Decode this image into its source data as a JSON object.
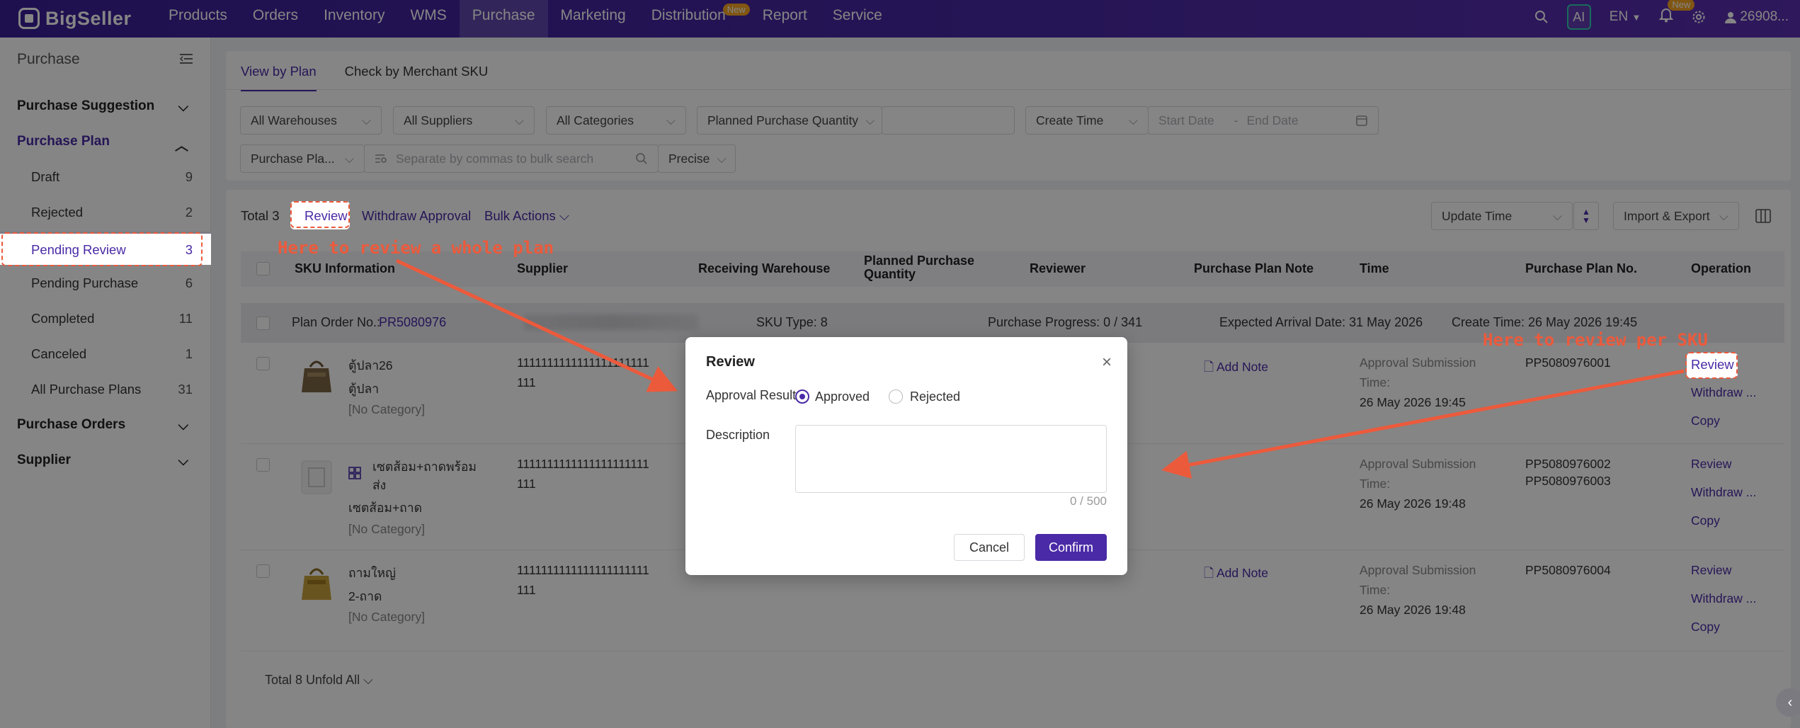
{
  "topbar": {
    "brand": "BigSeller",
    "nav": [
      "Products",
      "Orders",
      "Inventory",
      "WMS",
      "Purchase",
      "Marketing",
      "Distribution",
      "Report",
      "Service"
    ],
    "distribution_badge": "New",
    "ai": "AI",
    "lang": "EN",
    "bell_badge": "New",
    "user": "26908..."
  },
  "sidebar": {
    "title": "Purchase",
    "groups": {
      "suggestion": "Purchase Suggestion",
      "plan": "Purchase Plan",
      "orders": "Purchase Orders",
      "supplier": "Supplier"
    },
    "items": [
      {
        "label": "Draft",
        "count": "9"
      },
      {
        "label": "Rejected",
        "count": "2"
      },
      {
        "label": "Pending Review",
        "count": "3"
      },
      {
        "label": "Pending Purchase",
        "count": "6"
      },
      {
        "label": "Completed",
        "count": "11"
      },
      {
        "label": "Canceled",
        "count": "1"
      },
      {
        "label": "All Purchase Plans",
        "count": "31"
      }
    ]
  },
  "tabs": {
    "view_by_plan": "View by Plan",
    "check_by_sku": "Check by Merchant SKU"
  },
  "filters": {
    "warehouses": "All Warehouses",
    "suppliers": "All Suppliers",
    "categories": "All Categories",
    "quantity": "Planned Purchase Quantity",
    "create_time": "Create Time",
    "start_date": "Start Date",
    "end_date": "End Date",
    "plan_field": "Purchase Pla...",
    "search_placeholder": "Separate by commas to bulk search",
    "precise": "Precise"
  },
  "toolbar": {
    "total": "Total 3",
    "review": "Review",
    "withdraw": "Withdraw Approval",
    "bulk": "Bulk Actions",
    "update_time": "Update Time",
    "import_export": "Import & Export"
  },
  "table": {
    "headers": {
      "sku": "SKU Information",
      "supplier": "Supplier",
      "warehouse": "Receiving Warehouse",
      "qty": "Planned Purchase Quantity",
      "reviewer": "Reviewer",
      "note": "Purchase Plan Note",
      "time": "Time",
      "plan_no": "Purchase Plan No.",
      "operation": "Operation"
    },
    "plan": {
      "order_label": "Plan Order No.: ",
      "order_no": "PR5080976",
      "sku_type": "SKU Type: 8",
      "progress": "Purchase Progress: 0 / 341",
      "arrival": "Expected Arrival Date: 31 May 2026",
      "create": "Create Time: 26 May 2026 19:45"
    },
    "rows": [
      {
        "name": "ตู้ปลา26",
        "sub": "ตู้ปลา",
        "cat": "[No Category]",
        "supplier1": "1111111111111111111111",
        "supplier2": "111",
        "note": "Add Note",
        "time_label1": "Approval Submission",
        "time_label2": "Time:",
        "time": "26 May 2026 19:45",
        "plan_no": "PP5080976001",
        "plan_no2": "",
        "ops": [
          "Review",
          "Withdraw ...",
          "Copy"
        ]
      },
      {
        "name": "เซตส้อม+ถาดพร้อม",
        "name2": "ส่ง",
        "sub": "เซตส้อม+ถาด",
        "cat": "[No Category]",
        "supplier1": "1111111111111111111111",
        "supplier2": "111",
        "note": "",
        "time_label1": "Approval Submission",
        "time_label2": "Time:",
        "time": "26 May 2026 19:48",
        "plan_no": "PP5080976002",
        "plan_no2": "PP5080976003",
        "ops": [
          "Review",
          "Withdraw ...",
          "Copy"
        ]
      },
      {
        "name": "ถามใหญ่",
        "sub": "2-ถาด",
        "cat": "[No Category]",
        "supplier1": "1111111111111111111111",
        "supplier2": "111",
        "note": "Add Note",
        "time_label1": "Approval Submission",
        "time_label2": "Time:",
        "time": "26 May 2026 19:48",
        "plan_no": "PP5080976004",
        "plan_no2": "",
        "ops": [
          "Review",
          "Withdraw ...",
          "Copy"
        ]
      }
    ],
    "footer": "Total 8  Unfold All"
  },
  "modal": {
    "title": "Review",
    "approval_label": "Approval Result",
    "approved": "Approved",
    "rejected": "Rejected",
    "description_label": "Description",
    "count": "0 / 500",
    "cancel": "Cancel",
    "confirm": "Confirm"
  },
  "annotations": {
    "whole_plan": "Here to review a whole plan",
    "per_sku": "Here to review per SKU"
  },
  "colors": {
    "brand": "#4a2aa6",
    "annotation": "#ec5a3c"
  }
}
